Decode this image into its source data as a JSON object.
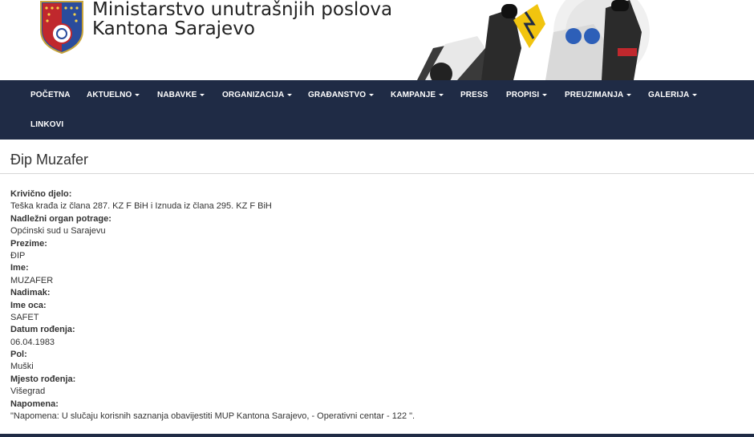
{
  "header": {
    "title_line1": "Ministarstvo unutrašnjih poslova",
    "title_line2": "Kantona Sarajevo"
  },
  "nav": {
    "items": [
      {
        "label": "POČETNA",
        "dropdown": false
      },
      {
        "label": "AKTUELNO",
        "dropdown": true
      },
      {
        "label": "NABAVKE",
        "dropdown": true
      },
      {
        "label": "ORGANIZACIJA",
        "dropdown": true
      },
      {
        "label": "GRAĐANSTVO",
        "dropdown": true
      },
      {
        "label": "KAMPANJE",
        "dropdown": true
      },
      {
        "label": "PRESS",
        "dropdown": false
      },
      {
        "label": "PROPISI",
        "dropdown": true
      },
      {
        "label": "PREUZIMANJA",
        "dropdown": true
      },
      {
        "label": "GALERIJA",
        "dropdown": true
      },
      {
        "label": "LINKOVI",
        "dropdown": false
      }
    ]
  },
  "page": {
    "title": "Đip Muzafer"
  },
  "details": {
    "fields": [
      {
        "label": "Krivično djelo:",
        "value": "Teška krađa iz člana 287. KZ F BiH i Iznuda iz člana 295. KZ F BiH"
      },
      {
        "label": "Nadležni organ potrage:",
        "value": "Općinski sud u Sarajevu"
      },
      {
        "label": "Prezime:",
        "value": "ĐIP"
      },
      {
        "label": "Ime:",
        "value": "MUZAFER"
      },
      {
        "label": "Nadimak:",
        "value": ""
      },
      {
        "label": "Ime oca:",
        "value": "SAFET"
      },
      {
        "label": "Datum rođenja:",
        "value": "06.04.1983"
      },
      {
        "label": "Pol:",
        "value": "Muški"
      },
      {
        "label": "Mjesto rođenja:",
        "value": "Višegrad"
      },
      {
        "label": "Napomena:",
        "value": "\"Napomena: U slučaju korisnih saznanja obavijestiti MUP Kantona Sarajevo, - Operativni centar - 122 \"."
      }
    ]
  },
  "colors": {
    "navbar_bg": "#1f2b45",
    "text": "#333333"
  }
}
